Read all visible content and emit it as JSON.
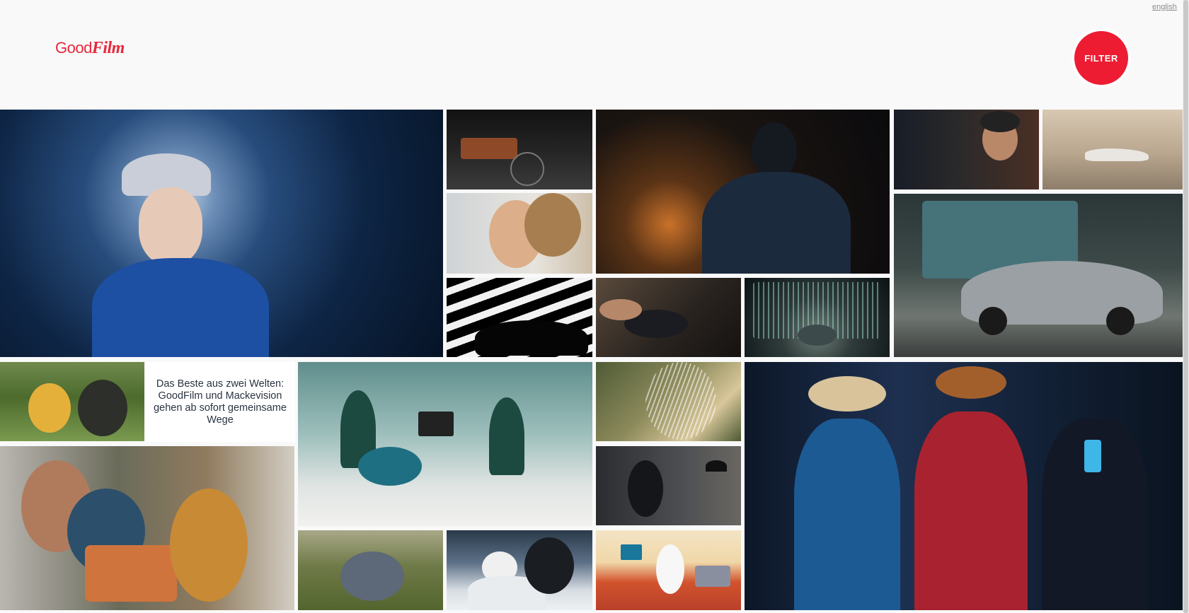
{
  "header": {
    "language_link": "english",
    "logo": {
      "part1": "Good",
      "part2": "Film"
    },
    "filter_label": "FILTER"
  },
  "colors": {
    "brand_red": "#ed1c32",
    "background": "#f9f9f9",
    "news_text": "#2a3340"
  },
  "news": {
    "headline": "Das Beste aus zwei Welten: GoodFilm und Mackevision gehen ab sofort gemeinsame Wege"
  }
}
